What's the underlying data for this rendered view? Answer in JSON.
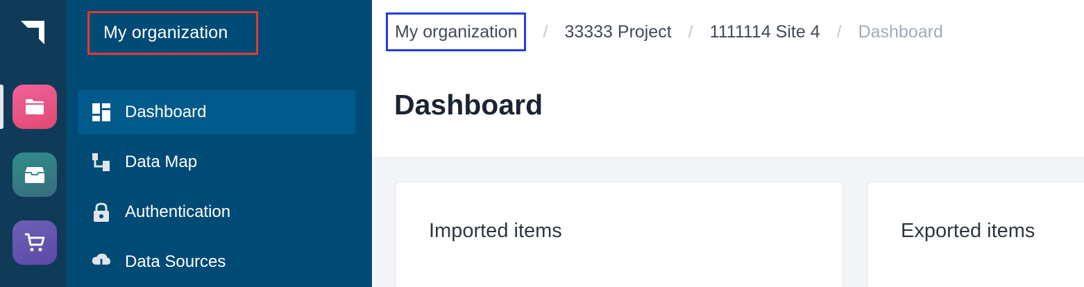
{
  "rail": {
    "apps": [
      {
        "name": "projects",
        "icon": "folder-icon",
        "color": "#e8507a"
      },
      {
        "name": "storage",
        "icon": "archive-box-icon",
        "color": "#2f8f8c"
      },
      {
        "name": "marketplace",
        "icon": "cart-icon",
        "color": "#6352ad"
      }
    ]
  },
  "sidebar": {
    "org_title": "My organization",
    "items": [
      {
        "label": "Dashboard",
        "icon": "dashboard-grid-icon",
        "active": true
      },
      {
        "label": "Data Map",
        "icon": "data-map-icon",
        "active": false
      },
      {
        "label": "Authentication",
        "icon": "lock-icon",
        "active": false
      },
      {
        "label": "Data Sources",
        "icon": "download-cloud-icon",
        "active": false
      }
    ]
  },
  "header": {
    "breadcrumb": [
      "My organization",
      "33333 Project",
      "1111114 Site 4",
      "Dashboard"
    ],
    "separator": "/",
    "title": "Dashboard"
  },
  "cards": [
    {
      "title": "Imported items"
    },
    {
      "title": "Exported items"
    }
  ],
  "colors": {
    "rail_bg": "#0f3b59",
    "sidebar_bg": "#004a76",
    "sidebar_active": "#005a8b",
    "highlight_red": "#e23b2e",
    "highlight_blue": "#1c3fe6"
  }
}
